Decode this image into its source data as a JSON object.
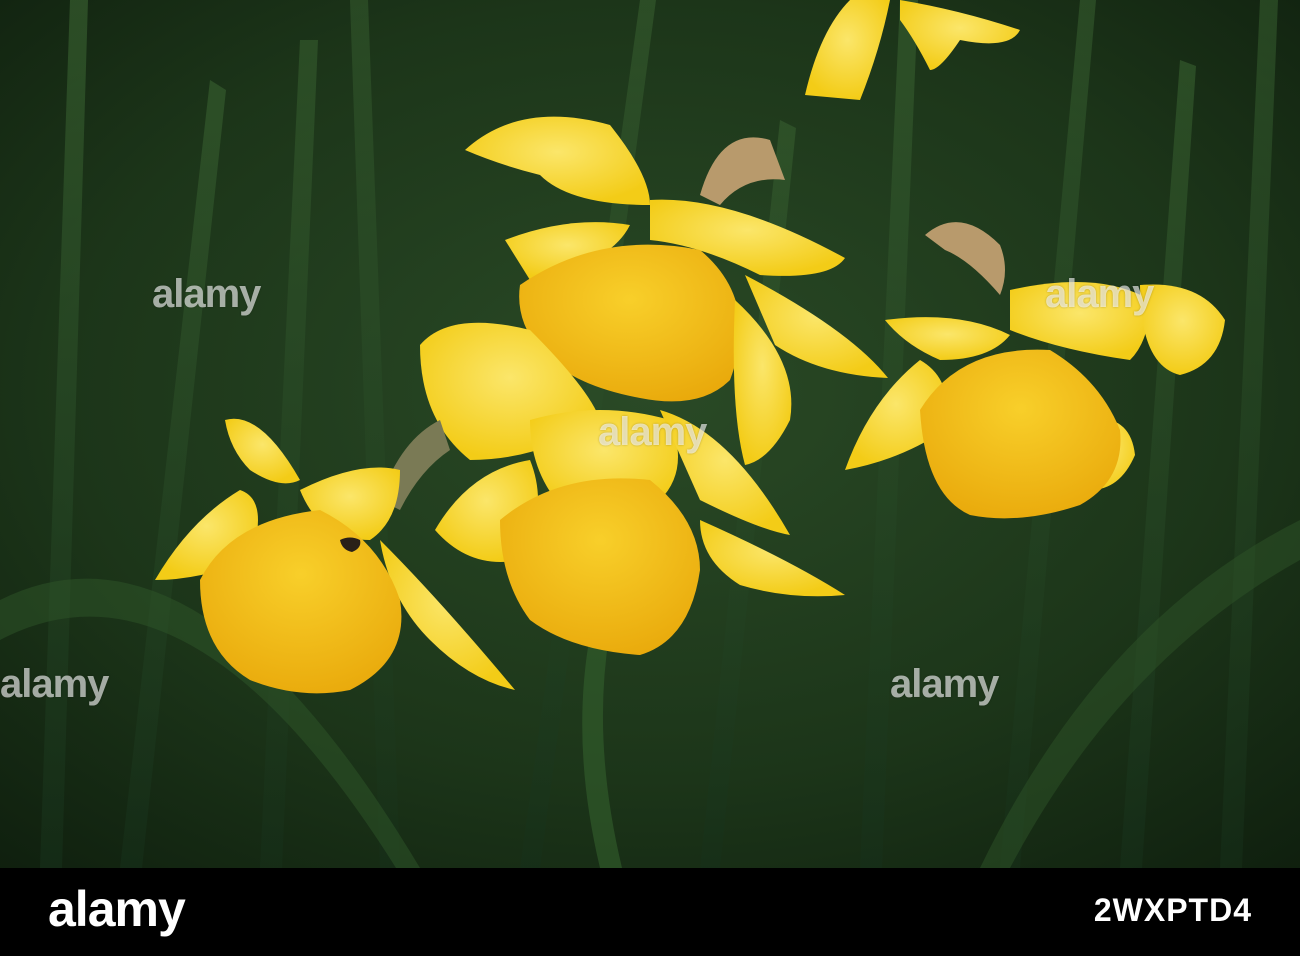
{
  "photo": {
    "watermark_text": "alamy"
  },
  "footer": {
    "logo_text": "alamy",
    "image_id": "2WXPTD4"
  },
  "colors": {
    "background_green": "#1f3a1e",
    "petal_yellow": "#f6d21c",
    "trumpet_yellow": "#f2b90f",
    "footer_black": "#000000"
  }
}
